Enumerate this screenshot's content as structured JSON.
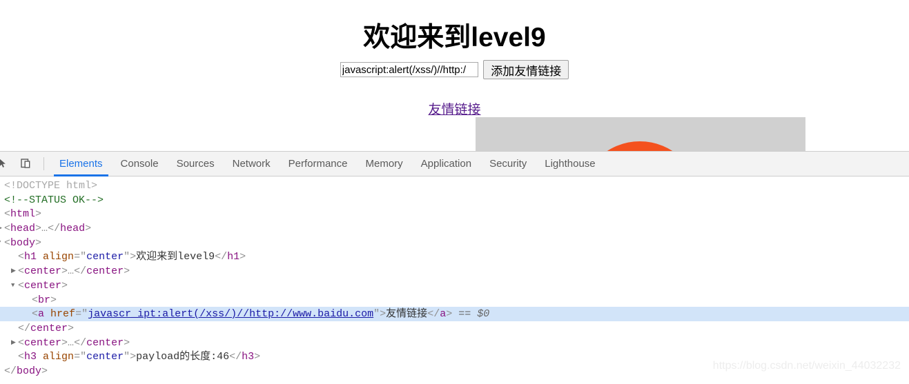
{
  "page": {
    "title": "欢迎来到level9",
    "input": {
      "value": "javascript:alert(/xss/)//http:/",
      "placeholder": ""
    },
    "add_button_label": "添加友情链接",
    "friend_link_label": "友情链接",
    "image_placeholder": {
      "bg_color": "#d0d0d0",
      "accent_color": "#f4511e"
    }
  },
  "devtools": {
    "icons": {
      "inspect": "inspect-element-icon",
      "device": "device-toolbar-icon"
    },
    "tabs": [
      {
        "label": "Elements",
        "active": true
      },
      {
        "label": "Console",
        "active": false
      },
      {
        "label": "Sources",
        "active": false
      },
      {
        "label": "Network",
        "active": false
      },
      {
        "label": "Performance",
        "active": false
      },
      {
        "label": "Memory",
        "active": false
      },
      {
        "label": "Application",
        "active": false
      },
      {
        "label": "Security",
        "active": false
      },
      {
        "label": "Lighthouse",
        "active": false
      }
    ],
    "active_tab_color": "#1a73e8",
    "selected_row_color": "#d2e4f9",
    "dom_lines": [
      {
        "id": "l0",
        "indent": 0,
        "arrow": "none",
        "selected": false,
        "text": "<!DOCTYPE html>"
      },
      {
        "id": "l1",
        "indent": 0,
        "arrow": "none",
        "selected": false,
        "text": "<!--STATUS OK-->"
      },
      {
        "id": "l2",
        "indent": 0,
        "arrow": "none",
        "selected": false,
        "text": "<html>"
      },
      {
        "id": "l3",
        "indent": 0,
        "arrow": "collapsed",
        "selected": false,
        "text": "<head>…</head>"
      },
      {
        "id": "l4",
        "indent": 0,
        "arrow": "expanded",
        "selected": false,
        "text": "<body>"
      },
      {
        "id": "l5",
        "indent": 1,
        "arrow": "none",
        "selected": false,
        "text": "<h1 align=\"center\">欢迎来到level9</h1>"
      },
      {
        "id": "l6",
        "indent": 1,
        "arrow": "collapsed",
        "selected": false,
        "text": "<center>…</center>"
      },
      {
        "id": "l7",
        "indent": 1,
        "arrow": "expanded",
        "selected": false,
        "text": "<center>"
      },
      {
        "id": "l8",
        "indent": 2,
        "arrow": "none",
        "selected": false,
        "text": "<br>"
      },
      {
        "id": "l9",
        "indent": 2,
        "arrow": "none",
        "selected": true,
        "text": "<a href=\"javascr_ipt:alert(/xss/)//http://www.baidu.com\">友情链接</a> == $0"
      },
      {
        "id": "l10",
        "indent": 1,
        "arrow": "none",
        "selected": false,
        "text": "</center>"
      },
      {
        "id": "l11",
        "indent": 1,
        "arrow": "collapsed",
        "selected": false,
        "text": "<center>…</center>"
      },
      {
        "id": "l12",
        "indent": 1,
        "arrow": "none",
        "selected": false,
        "text": "<h3 align=\"center\">payload的长度:46</h3>"
      },
      {
        "id": "l13",
        "indent": 0,
        "arrow": "none",
        "selected": false,
        "text": "</body>"
      }
    ],
    "dom_tokens": {
      "doctype": "<!DOCTYPE html>",
      "status_comment": "<!--STATUS OK-->",
      "href_value": "javascr_ipt:alert(/xss/)//http://www.baidu.com",
      "anchor_text": "友情链接",
      "h1_text": "欢迎来到level9",
      "h3_text": "payload的长度:46",
      "align_attr": "align",
      "align_value": "center",
      "href_attr": "href",
      "selected_marker": "== $0",
      "ellipsis": "…"
    }
  },
  "watermark": {
    "text": "https://blog.csdn.net/weixin_44032232"
  }
}
